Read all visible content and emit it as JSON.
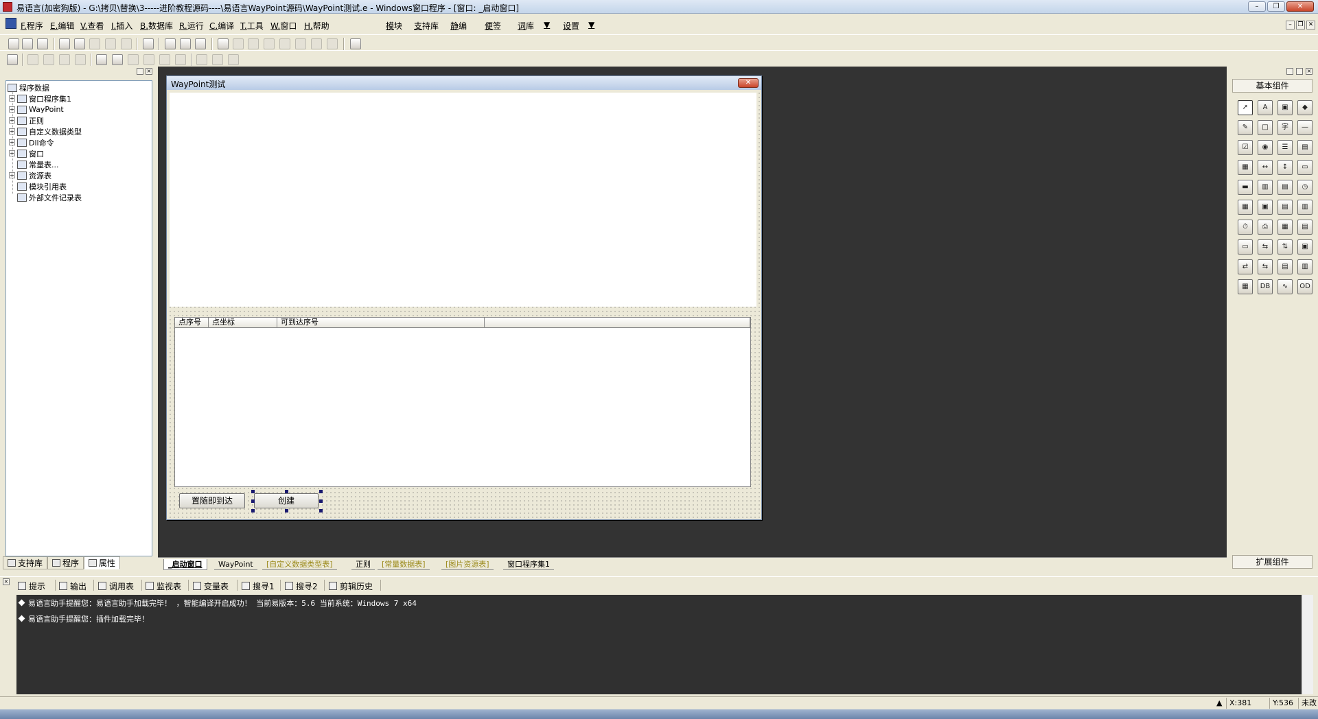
{
  "window": {
    "title": "易语言(加密狗版) - G:\\拷贝\\替换\\3-----进阶教程源码----\\易语言WayPoint源码\\WayPoint测试.e - Windows窗口程序 - [窗口: _启动窗口]",
    "min": "–",
    "max": "❐",
    "close": "✕"
  },
  "menu": {
    "items": [
      "F.程序",
      "E.编辑",
      "V.查看",
      "I.插入",
      "B.数据库",
      "R.运行",
      "C.编译",
      "T.工具",
      "W.窗口",
      "H.帮助"
    ],
    "extras": [
      "模块",
      "支持库",
      "静编",
      "便签",
      "词库",
      "设置"
    ],
    "dropdown": "▼"
  },
  "tree": {
    "root": "程序数据",
    "items": [
      "窗口程序集1",
      "WayPoint",
      "正则",
      "自定义数据类型",
      "Dll命令",
      "窗口",
      "常量表...",
      "资源表",
      "模块引用表",
      "外部文件记录表"
    ]
  },
  "left_tabs": [
    "支持库",
    "程序",
    "属性"
  ],
  "form": {
    "title": "WayPoint测试",
    "columns": [
      "点序号",
      "点坐标",
      "可到达序号"
    ],
    "button1": "置随即到达",
    "button2": "创建"
  },
  "doc_tabs": [
    "_启动窗口",
    "WayPoint",
    "[自定义数据类型表]",
    "正则",
    "[常量数据表]",
    "[图片资源表]",
    "窗口程序集1"
  ],
  "palette": {
    "header": "基本组件",
    "footer": "扩展组件",
    "icons": [
      "arrow-pointer",
      "label",
      "picture",
      "shape",
      "edit",
      "frame",
      "char",
      "line",
      "checkbox",
      "radio",
      "listbox",
      "combobox",
      "grid",
      "scroll-h",
      "scroll-v",
      "progress",
      "slider",
      "tab",
      "tabbar",
      "clock",
      "table",
      "folder",
      "driver",
      "file",
      "timer",
      "printer",
      "cell",
      "thread",
      "animation",
      "net",
      "tree",
      "panel",
      "socket-server",
      "socket-client",
      "data-source",
      "data-provider",
      "db",
      "odbc",
      "chart",
      "odbc-db"
    ],
    "glyphs": [
      "➚",
      "A",
      "▣",
      "◆",
      "✎",
      "□",
      "字",
      "—",
      "☑",
      "◉",
      "☰",
      "▤",
      "▦",
      "↔",
      "↕",
      "▭",
      "▬",
      "▥",
      "▤",
      "◷",
      "▦",
      "▣",
      "▤",
      "▥",
      "⏱",
      "⎙",
      "▦",
      "▤",
      "▭",
      "⇆",
      "⇅",
      "▣",
      "⇄",
      "⇆",
      "▤",
      "▥",
      "▦",
      "DB",
      "∿",
      "OD"
    ]
  },
  "output": {
    "tabs": [
      "提示",
      "输出",
      "调用表",
      "监视表",
      "变量表",
      "搜寻1",
      "搜寻2",
      "剪辑历史"
    ],
    "lines": [
      "易语言助手提醒您：易语言助手加载完毕！ ，智能编译开启成功！ 当前易版本：5.6  当前系统：Windows 7 x64",
      "易语言助手提醒您：插件加载完毕！"
    ]
  },
  "status": {
    "x": "X:381",
    "y": "Y:536",
    "mode": "未改"
  }
}
